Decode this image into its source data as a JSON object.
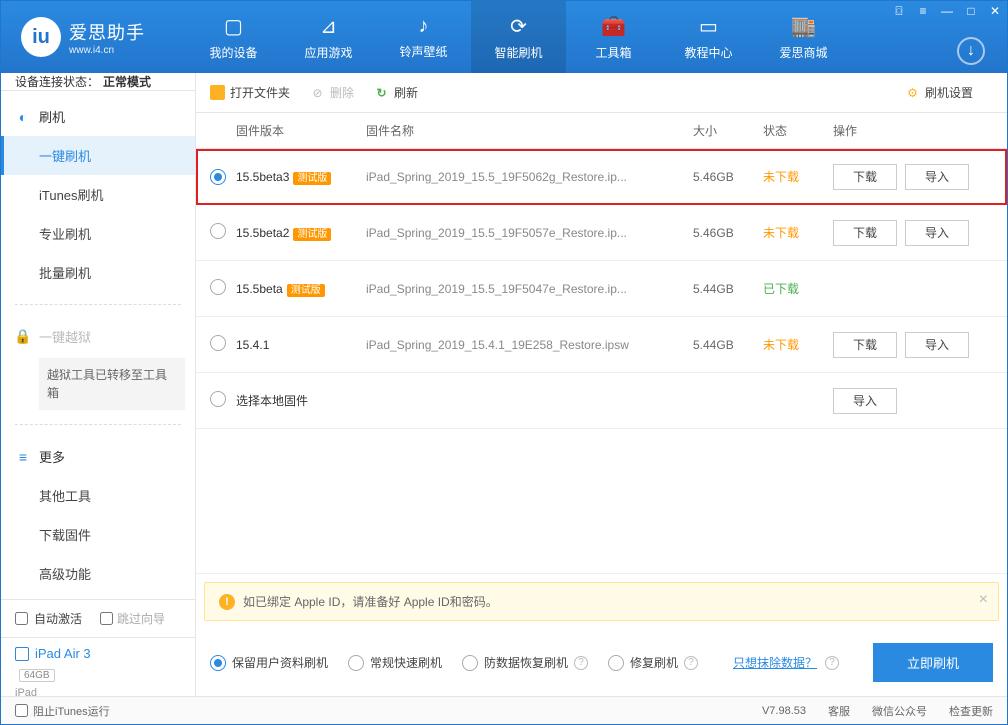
{
  "logo": {
    "title": "爱思助手",
    "sub": "www.i4.cn"
  },
  "nav": [
    {
      "label": "我的设备"
    },
    {
      "label": "应用游戏"
    },
    {
      "label": "铃声壁纸"
    },
    {
      "label": "智能刷机"
    },
    {
      "label": "工具箱"
    },
    {
      "label": "教程中心"
    },
    {
      "label": "爱思商城"
    }
  ],
  "device_status": {
    "label": "设备连接状态：",
    "value": "正常模式"
  },
  "sidebar": {
    "flash": {
      "title": "刷机",
      "items": [
        "一键刷机",
        "iTunes刷机",
        "专业刷机",
        "批量刷机"
      ]
    },
    "jailbreak": {
      "title": "一键越狱",
      "notice": "越狱工具已转移至工具箱"
    },
    "more": {
      "title": "更多",
      "items": [
        "其他工具",
        "下载固件",
        "高级功能"
      ]
    }
  },
  "sidebar_bottom": {
    "auto_activate": "自动激活",
    "jump_guide": "跳过向导",
    "device_name": "iPad Air 3",
    "device_cap": "64GB",
    "device_type": "iPad"
  },
  "toolbar": {
    "open_folder": "打开文件夹",
    "delete": "删除",
    "refresh": "刷新",
    "settings": "刷机设置"
  },
  "table": {
    "headers": {
      "version": "固件版本",
      "name": "固件名称",
      "size": "大小",
      "status": "状态",
      "ops": "操作"
    },
    "rows": [
      {
        "selected": true,
        "version": "15.5beta3",
        "beta": "测试版",
        "name": "iPad_Spring_2019_15.5_19F5062g_Restore.ip...",
        "size": "5.46GB",
        "status": "未下载",
        "status_class": "status-orange",
        "download": "下载",
        "import": "导入",
        "highlighted": true
      },
      {
        "selected": false,
        "version": "15.5beta2",
        "beta": "测试版",
        "name": "iPad_Spring_2019_15.5_19F5057e_Restore.ip...",
        "size": "5.46GB",
        "status": "未下载",
        "status_class": "status-orange",
        "download": "下载",
        "import": "导入"
      },
      {
        "selected": false,
        "version": "15.5beta",
        "beta": "测试版",
        "name": "iPad_Spring_2019_15.5_19F5047e_Restore.ip...",
        "size": "5.44GB",
        "status": "已下载",
        "status_class": "status-green",
        "download": "",
        "import": ""
      },
      {
        "selected": false,
        "version": "15.4.1",
        "beta": "",
        "name": "iPad_Spring_2019_15.4.1_19E258_Restore.ipsw",
        "size": "5.44GB",
        "status": "未下载",
        "status_class": "status-orange",
        "download": "下载",
        "import": "导入"
      },
      {
        "selected": false,
        "version": "选择本地固件",
        "beta": "",
        "name": "",
        "size": "",
        "status": "",
        "status_class": "",
        "download": "",
        "import": "导入"
      }
    ]
  },
  "alert": {
    "text": "如已绑定 Apple ID，请准备好 Apple ID和密码。"
  },
  "action": {
    "opts": [
      "保留用户资料刷机",
      "常规快速刷机",
      "防数据恢复刷机",
      "修复刷机"
    ],
    "erase_link": "只想抹除数据？",
    "primary": "立即刷机"
  },
  "statusbar": {
    "block_itunes": "阻止iTunes运行",
    "version": "V7.98.53",
    "items": [
      "客服",
      "微信公众号",
      "检查更新"
    ]
  }
}
